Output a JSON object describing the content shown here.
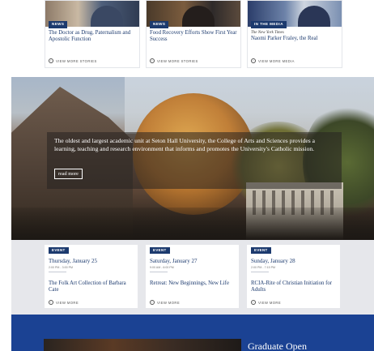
{
  "news": [
    {
      "tag": "NEWS",
      "source": "",
      "title": "The Doctor as Drug, Paternalism and Apostolic Function",
      "more_label": "VIEW MORE STORIES",
      "more_icon": "arrow-circle-icon"
    },
    {
      "tag": "NEWS",
      "source": "",
      "title": "Food Recovery Efforts Show First Year Success",
      "more_label": "VIEW MORE STORIES",
      "more_icon": "arrow-circle-icon"
    },
    {
      "tag": "IN THE MEDIA",
      "source": "The New York Times",
      "title": "Naomi Parker Fraley, the Real",
      "more_label": "VIEW MORE MEDIA",
      "more_icon": "arrow-circle-icon"
    }
  ],
  "hero": {
    "intro": "The oldest and largest academic unit at Seton Hall University, the College of Arts and Sciences provides a learning, teaching and research environment that informs and promotes the University's Catholic mission.",
    "read_more": "read more"
  },
  "events": [
    {
      "tag": "EVENT",
      "date": "Thursday, January 25",
      "time": "2:00 PM - 3:00 PM",
      "title": "The Folk Art Collection of Barbara Cate",
      "more_label": "VIEW MORE"
    },
    {
      "tag": "EVENT",
      "date": "Saturday, January 27",
      "time": "9:00 AM - 6:00 PM",
      "title": "Retreat: New Beginnings, New Life",
      "more_label": "VIEW MORE"
    },
    {
      "tag": "EVENT",
      "date": "Sunday, January 28",
      "time": "2:00 PM - 7:15 PM",
      "title": "RCIA-Rite of Christian Initiation for Adults",
      "more_label": "VIEW MORE"
    }
  ],
  "graduate": {
    "title": "Graduate Open"
  },
  "colors": {
    "brand_blue": "#1c3a6e",
    "band_blue": "#1b4293",
    "events_bg": "#e6e7eb"
  }
}
